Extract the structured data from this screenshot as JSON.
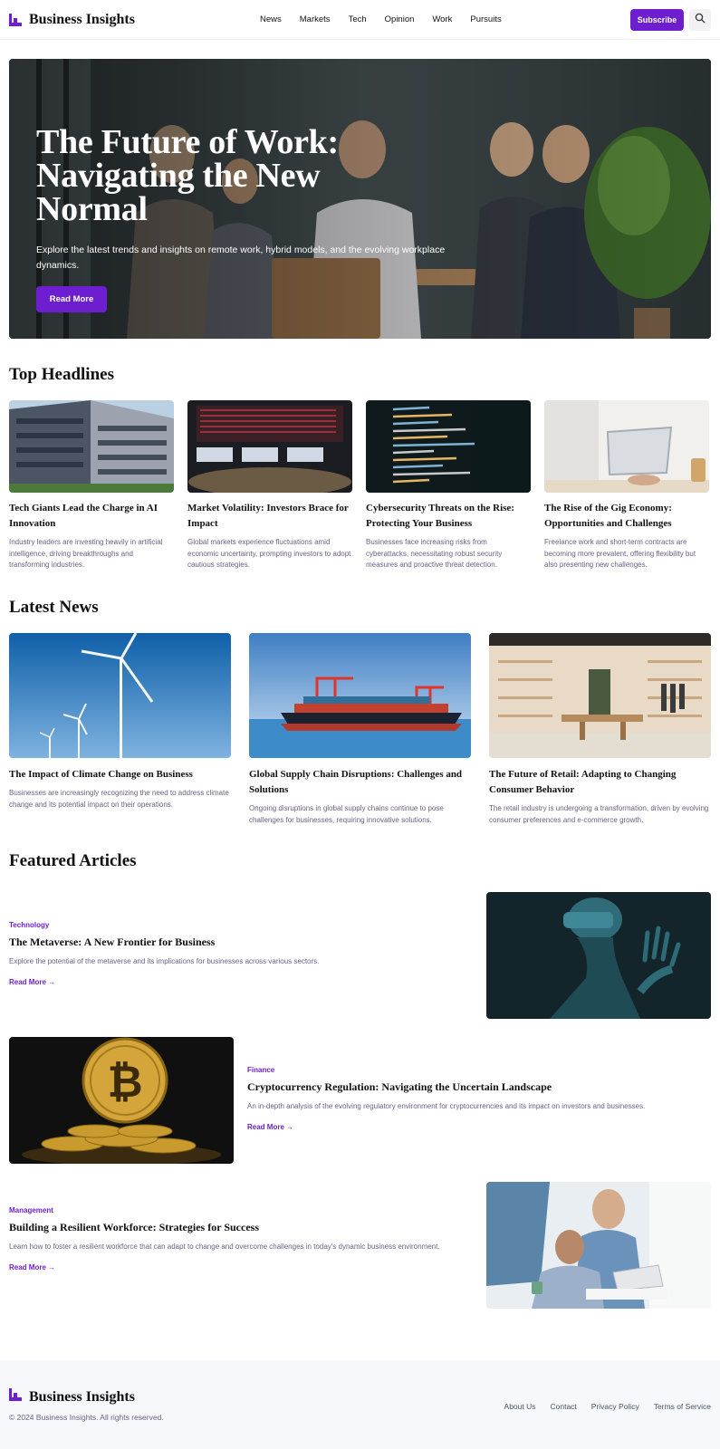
{
  "header": {
    "brand": "Business Insights",
    "nav": [
      "News",
      "Markets",
      "Tech",
      "Opinion",
      "Work",
      "Pursuits"
    ],
    "subscribe_label": "Subscribe",
    "search_icon": "search-icon"
  },
  "hero": {
    "title_line1": "The Future of Work:",
    "title_line2": "Navigating the New",
    "title_line3": "Normal",
    "subtitle": "Explore the latest trends and insights on remote work, hybrid models, and the evolving workplace dynamics.",
    "button": "Read More"
  },
  "top_headlines": {
    "title": "Top Headlines",
    "items": [
      {
        "title": "Tech Giants Lead the Charge in AI Innovation",
        "desc": "Industry leaders are investing heavily in artificial intelligence, driving breakthroughs and transforming industries."
      },
      {
        "title": "Market Volatility: Investors Brace for Impact",
        "desc": "Global markets experience fluctuations amid economic uncertainty, prompting investors to adopt cautious strategies."
      },
      {
        "title": "Cybersecurity Threats on the Rise: Protecting Your Business",
        "desc": "Businesses face increasing risks from cyberattacks, necessitating robust security measures and proactive threat detection."
      },
      {
        "title": "The Rise of the Gig Economy: Opportunities and Challenges",
        "desc": "Freelance work and short-term contracts are becoming more prevalent, offering flexibility but also presenting new challenges."
      }
    ]
  },
  "latest_news": {
    "title": "Latest News",
    "items": [
      {
        "title": "The Impact of Climate Change on Business",
        "desc": "Businesses are increasingly recognizing the need to address climate change and its potential impact on their operations."
      },
      {
        "title": "Global Supply Chain Disruptions: Challenges and Solutions",
        "desc": "Ongoing disruptions in global supply chains continue to pose challenges for businesses, requiring innovative solutions."
      },
      {
        "title": "The Future of Retail: Adapting to Changing Consumer Behavior",
        "desc": "The retail industry is undergoing a transformation, driven by evolving consumer preferences and e-commerce growth."
      }
    ]
  },
  "featured": {
    "title": "Featured Articles",
    "items": [
      {
        "category": "Technology",
        "title": "The Metaverse: A New Frontier for Business",
        "desc": "Explore the potential of the metaverse and its implications for businesses across various sectors.",
        "link": "Read More →"
      },
      {
        "category": "Finance",
        "title": "Cryptocurrency Regulation: Navigating the Uncertain Landscape",
        "desc": "An in-depth analysis of the evolving regulatory environment for cryptocurrencies and its impact on investors and businesses.",
        "link": "Read More →"
      },
      {
        "category": "Management",
        "title": "Building a Resilient Workforce: Strategies for Success",
        "desc": "Learn how to foster a resilient workforce that can adapt to change and overcome challenges in today's dynamic business environment.",
        "link": "Read More →"
      }
    ]
  },
  "footer": {
    "brand": "Business Insights",
    "copyright": "© 2024 Business Insights. All rights reserved.",
    "links": [
      "About Us",
      "Contact",
      "Privacy Policy",
      "Terms of Service"
    ]
  },
  "colors": {
    "accent": "#6d1fd0",
    "muted_text": "#6b6184",
    "footer_bg": "#f7f8fb"
  }
}
